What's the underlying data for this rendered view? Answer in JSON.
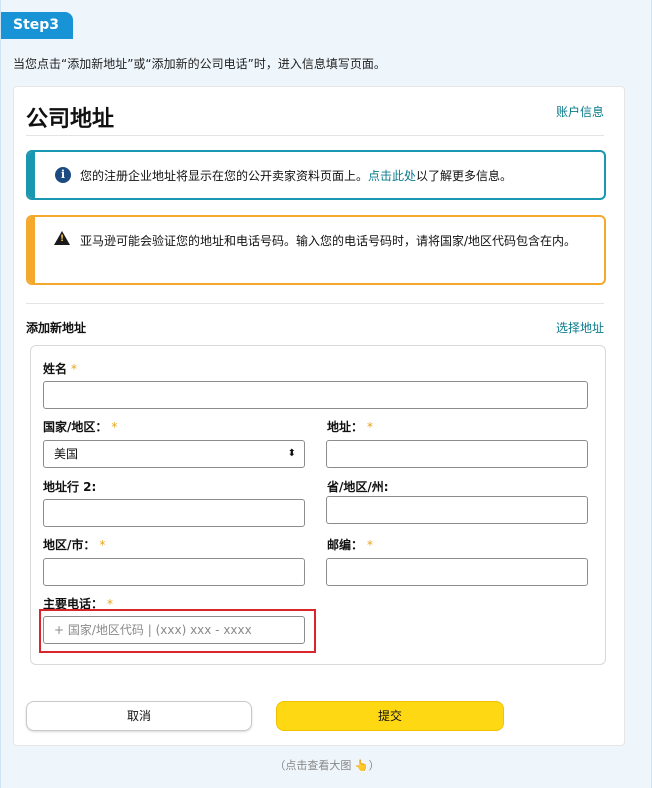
{
  "step_label": "Step3",
  "intro_text": "当您点击“添加新地址”或“添加新的公司电话”时，进入信息填写页面。",
  "card": {
    "title": "公司地址",
    "account_link": "账户信息"
  },
  "info_box": {
    "icon": "info-icon",
    "text_before": "您的注册企业地址将显示在您的公开卖家资料页面上。",
    "link_text": "点击此处",
    "text_after": "以了解更多信息。"
  },
  "warning_box": {
    "icon": "warning-icon",
    "text": "亚马逊可能会验证您的地址和电话号码。输入您的电话号码时，请将国家/地区代码包含在内。"
  },
  "section": {
    "title": "添加新地址",
    "select_link": "选择地址"
  },
  "form": {
    "name_label": "姓名",
    "country_label": "国家/地区：",
    "country_value": "美国",
    "address_label": "地址：",
    "address2_label": "地址行 2:",
    "state_label": "省/地区/州:",
    "city_label": "地区/市：",
    "zip_label": "邮编：",
    "phone_label": "主要电话：",
    "phone_placeholder": "+ 国家/地区代码 | (xxx) xxx - xxxx",
    "required_mark": "*"
  },
  "buttons": {
    "cancel": "取消",
    "submit": "提交"
  },
  "caption": "（点击查看大图 👆）",
  "colors": {
    "step_tag": "#1894d6",
    "link": "#0a7b8c",
    "info_border": "#1a97b0",
    "warning_border": "#f4a92c",
    "submit_button": "#ffd814",
    "highlight_box": "#d9262c"
  }
}
